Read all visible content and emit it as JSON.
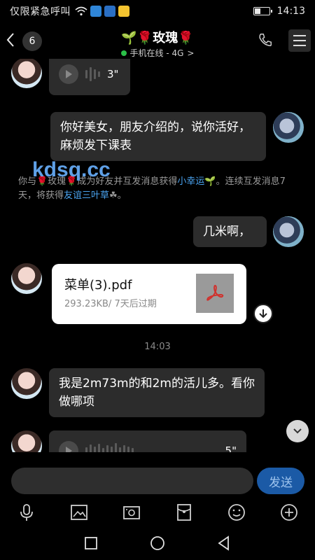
{
  "status_bar": {
    "carrier": "仅限紧急呼叫",
    "time": "14:13",
    "battery_level": 0.4
  },
  "header": {
    "unread_count": "6",
    "contact_name": "🌱🌹玫瑰🌹",
    "online_status": "手机在线 - 4G",
    "online_chevron": ">"
  },
  "messages": {
    "voice_1_duration": "3\"",
    "sent_1": "你好美女，朋友介绍的，说你活好，麻烦发下课表",
    "sys_part1": "你与🌹玫瑰🌹成为好友并互发消息获得",
    "sys_link1": "小幸运",
    "sys_part2": "🌱。连续互发消息7天，将获得",
    "sys_link2": "友谊三叶草",
    "sys_part3": "☘。",
    "watermark": "kdsq.cc",
    "sent_2": "几米啊，",
    "file_name": "菜单(3).pdf",
    "file_meta": "293.23KB/ 7天后过期",
    "time_sep": "14:03",
    "recv_2": "我是2m73m的和2m的活儿多。看你做哪项",
    "voice_2_duration": "5\""
  },
  "input": {
    "placeholder": "",
    "send_label": "发送"
  },
  "colors": {
    "accent": "#1b5aa6",
    "online": "#2bc048",
    "link": "#4aa3f0"
  }
}
